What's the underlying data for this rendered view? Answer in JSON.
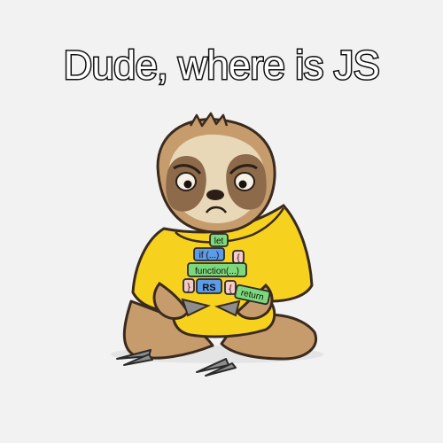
{
  "caption": "Dude, where is JS",
  "code_blocks": {
    "let": "let",
    "if": "if (...)",
    "brace_1": "{",
    "function": "function(...)",
    "brace_2": "}",
    "rs": "RS",
    "brace_3": "{",
    "return": "return"
  },
  "colors": {
    "background": "#f2f2f2",
    "shirt": "#f6d21f",
    "fur": "#c69c6d",
    "face_mask": "#8c6a4a",
    "face_light": "#e8d8b8",
    "block_green": "#7dd87b",
    "block_blue": "#5b9be8",
    "block_pink": "#f7c9c9"
  }
}
